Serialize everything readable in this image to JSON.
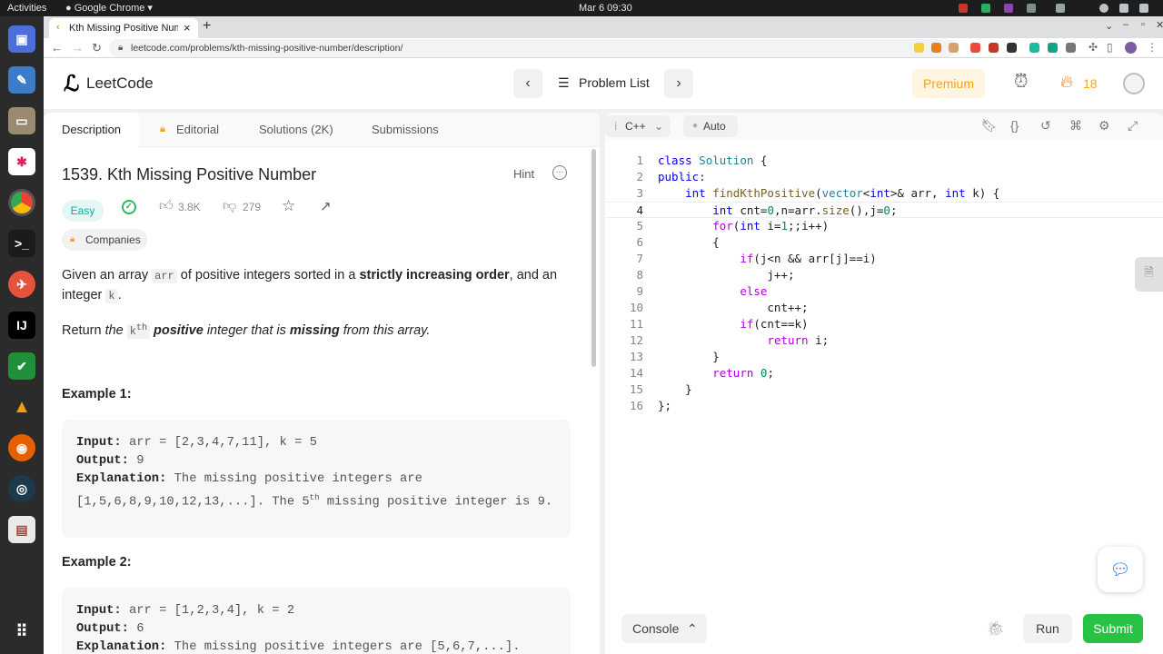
{
  "system": {
    "activities": "Activities",
    "app_menu": "Google Chrome",
    "clock": "Mar 6  09:30"
  },
  "browser": {
    "tab_title": "Kth Missing Positive Num",
    "tab_close": "×",
    "new_tab": "+",
    "url": "leetcode.com/problems/kth-missing-positive-number/description/"
  },
  "header": {
    "logo_text": "LeetCode",
    "problem_list": "Problem List",
    "premium": "Premium",
    "streak_count": "18"
  },
  "left_tabs": [
    {
      "label": "Description"
    },
    {
      "label": "Editorial"
    },
    {
      "label": "Solutions (2K)"
    },
    {
      "label": "Submissions"
    }
  ],
  "problem": {
    "title": "1539. Kth Missing Positive Number",
    "hint": "Hint",
    "difficulty": "Easy",
    "likes": "3.8K",
    "dislikes": "279",
    "companies": "Companies",
    "desc1_pre": "Given an array ",
    "desc1_code": "arr",
    "desc1_mid": " of positive integers sorted in a ",
    "desc1_bold": "strictly increasing order",
    "desc1_post": ", and an integer ",
    "desc1_code2": "k",
    "desc1_end": ".",
    "desc2_pre": "Return ",
    "desc2_the": "the ",
    "desc2_k": "k",
    "desc2_th": "th",
    "desc2_bold1": "positive",
    "desc2_mid": " integer that is ",
    "desc2_bold2": "missing",
    "desc2_end": " from this array."
  },
  "examples": [
    {
      "heading": "Example 1:",
      "input_label": "Input:",
      "input": " arr = [2,3,4,7,11], k = 5",
      "output_label": "Output:",
      "output": " 9",
      "explanation_label": "Explanation:",
      "explanation_a": " The missing positive integers are [1,5,6,8,9,10,12,13,...]. The 5",
      "explanation_sup": "th",
      "explanation_b": " missing positive integer is 9."
    },
    {
      "heading": "Example 2:",
      "input_label": "Input:",
      "input": " arr = [1,2,3,4], k = 2",
      "output_label": "Output:",
      "output": " 6",
      "explanation_label": "Explanation:",
      "explanation_a": " The missing positive integers are [5,6,7,...]."
    }
  ],
  "editor": {
    "language": "C++",
    "mode": "Auto",
    "console": "Console",
    "run": "Run",
    "submit": "Submit",
    "line_numbers": [
      "1",
      "2",
      "3",
      "4",
      "5",
      "6",
      "7",
      "8",
      "9",
      "10",
      "11",
      "12",
      "13",
      "14",
      "15",
      "16"
    ]
  },
  "colors": {
    "accent_green": "#2cbb5d",
    "submit_bg": "#28c244",
    "premium": "#ffa116",
    "easy_text": "#00af9b",
    "easy_bg": "#e5f7f5"
  }
}
